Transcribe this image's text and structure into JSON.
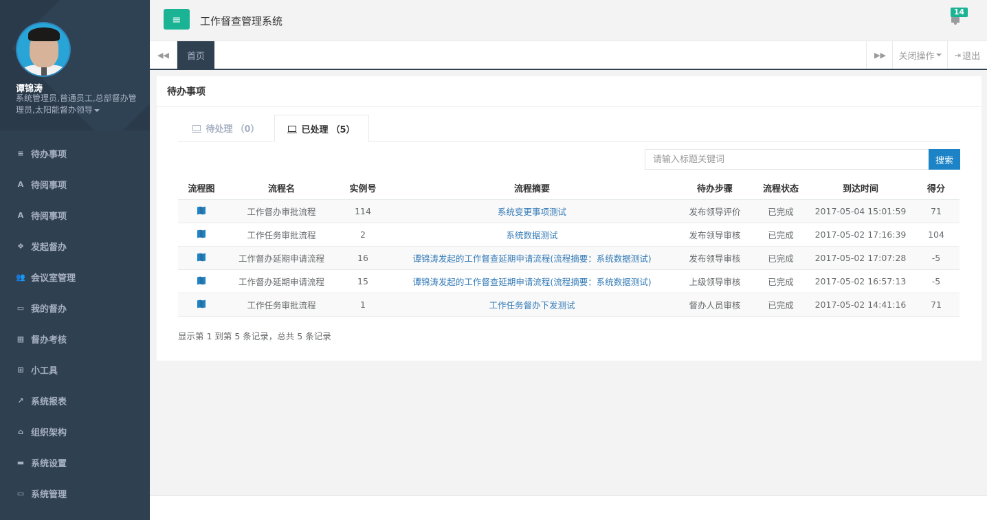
{
  "user": {
    "name": "谭锦涛",
    "roles": "系统管理员,普通员工,总部督办管理员,太阳能督办领导"
  },
  "sidebar": {
    "items": [
      {
        "label": "待办事项",
        "icon": "list-icon",
        "glyph": "≡"
      },
      {
        "label": "待阅事项",
        "icon": "font-icon",
        "glyph": "A"
      },
      {
        "label": "待阅事项",
        "icon": "font-icon",
        "glyph": "A"
      },
      {
        "label": "发起督办",
        "icon": "cubes-icon",
        "glyph": "❖"
      },
      {
        "label": "会议室管理",
        "icon": "users-icon",
        "glyph": "👥"
      },
      {
        "label": "我的督办",
        "icon": "laptop-icon",
        "glyph": "▭"
      },
      {
        "label": "督办考核",
        "icon": "calendar-icon",
        "glyph": "▦"
      },
      {
        "label": "小工具",
        "icon": "toolbox-icon",
        "glyph": "⊞"
      },
      {
        "label": "系统报表",
        "icon": "line-chart-icon",
        "glyph": "↗"
      },
      {
        "label": "组织架构",
        "icon": "bank-icon",
        "glyph": "⌂"
      },
      {
        "label": "系统设置",
        "icon": "credit-card-icon",
        "glyph": "▬"
      },
      {
        "label": "系统管理",
        "icon": "desktop-icon",
        "glyph": "▭"
      }
    ]
  },
  "header": {
    "title": "工作督查管理系统",
    "notification_count": "14"
  },
  "tabbar": {
    "home": "首页",
    "close_ops": "关闭操作",
    "logout": "退出"
  },
  "panel": {
    "title": "待办事项",
    "tabs": [
      {
        "label": "待处理",
        "count": "（0）"
      },
      {
        "label": "已处理",
        "count": "（5）"
      }
    ],
    "search": {
      "placeholder": "请输入标题关键词",
      "button": "搜索"
    },
    "columns": [
      "流程图",
      "流程名",
      "实例号",
      "流程摘要",
      "待办步骤",
      "流程状态",
      "到达时间",
      "得分"
    ],
    "rows": [
      {
        "name": "工作督办审批流程",
        "id": "114",
        "summary": "系统变更事项测试",
        "step": "发布领导评价",
        "status": "已完成",
        "time": "2017-05-04 15:01:59",
        "score": "71"
      },
      {
        "name": "工作任务审批流程",
        "id": "2",
        "summary": "系统数据测试",
        "step": "发布领导审核",
        "status": "已完成",
        "time": "2017-05-02 17:16:39",
        "score": "104"
      },
      {
        "name": "工作督办延期申请流程",
        "id": "16",
        "summary": "谭锦涛发起的工作督查延期申请流程(流程摘要：系统数据测试)",
        "step": "发布领导审核",
        "status": "已完成",
        "time": "2017-05-02 17:07:28",
        "score": "-5"
      },
      {
        "name": "工作督办延期申请流程",
        "id": "15",
        "summary": "谭锦涛发起的工作督查延期申请流程(流程摘要：系统数据测试)",
        "step": "上级领导审核",
        "status": "已完成",
        "time": "2017-05-02 16:57:13",
        "score": "-5"
      },
      {
        "name": "工作任务审批流程",
        "id": "1",
        "summary": "工作任务督办下发测试",
        "step": "督办人员审核",
        "status": "已完成",
        "time": "2017-05-02 14:41:16",
        "score": "71"
      }
    ],
    "pager_info": "显示第 1 到第 5 条记录，总共 5 条记录"
  },
  "colors": {
    "sidebar": "#2f4050",
    "accent": "#1ab394",
    "primary": "#1c84c6",
    "link": "#337ab7"
  }
}
